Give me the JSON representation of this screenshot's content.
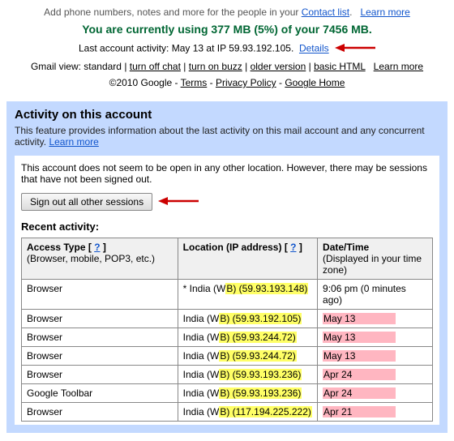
{
  "top": {
    "addText": "Add phone numbers, notes and more for the people in your ",
    "contactLink": "Contact list",
    "learnMore": "Learn more",
    "storage": "You are currently using 377 MB (5%) of your 7456 MB.",
    "activityPrefix": "Last account activity: May 13 at IP 59.93.192.105.",
    "detailsLink": "Details",
    "viewPrefix": "Gmail view: ",
    "viewStandard": "standard",
    "viewTurnOffChat": "turn off chat",
    "viewTurnOnBuzz": "turn on buzz",
    "viewOlder": "older version",
    "viewBasic": "basic HTML",
    "copyright": "©2010 Google - ",
    "terms": "Terms",
    "privacy": "Privacy Policy",
    "googleHome": "Google Home"
  },
  "panel": {
    "title": "Activity on this account",
    "desc": "This feature provides information about the last activity on this mail account and any concurrent activity. ",
    "learnMore": "Learn more",
    "notice": "This account does not seem to be open in any other location. However, there may be sessions that have not been signed out.",
    "signOutBtn": "Sign out all other sessions",
    "recentTitle": "Recent activity:",
    "headers": {
      "accessType": "Access Type",
      "accessSub": "(Browser, mobile, POP3, etc.)",
      "location": "Location (IP address)",
      "datetime": "Date/Time",
      "datetimeSub": "(Displayed in your time zone)",
      "help": "?"
    },
    "rows": [
      {
        "access": "Browser",
        "locPrefix": "* India (W",
        "locIpPart": "B) (59.93.193.148)",
        "date": "9:06 pm (0 minutes ago)",
        "hlDate": false
      },
      {
        "access": "Browser",
        "locPrefix": "India (W",
        "locIpPart": "B) (59.93.192.105)",
        "date": "May 13",
        "hlDate": true
      },
      {
        "access": "Browser",
        "locPrefix": "India (W",
        "locIpPart": "B) (59.93.244.72)",
        "date": "May 13",
        "hlDate": true
      },
      {
        "access": "Browser",
        "locPrefix": "India (W",
        "locIpPart": "B) (59.93.244.72)",
        "date": "May 13",
        "hlDate": true
      },
      {
        "access": "Browser",
        "locPrefix": "India (W",
        "locIpPart": "B) (59.93.193.236)",
        "date": "Apr 24",
        "hlDate": true
      },
      {
        "access": "Google Toolbar",
        "locPrefix": "India (W",
        "locIpPart": "B) (59.93.193.236)",
        "date": "Apr 24",
        "hlDate": true
      },
      {
        "access": "Browser",
        "locPrefix": "India (W",
        "locIpPart": "B) (117.194.225.222)",
        "date": "Apr 21",
        "hlDate": true
      }
    ]
  }
}
